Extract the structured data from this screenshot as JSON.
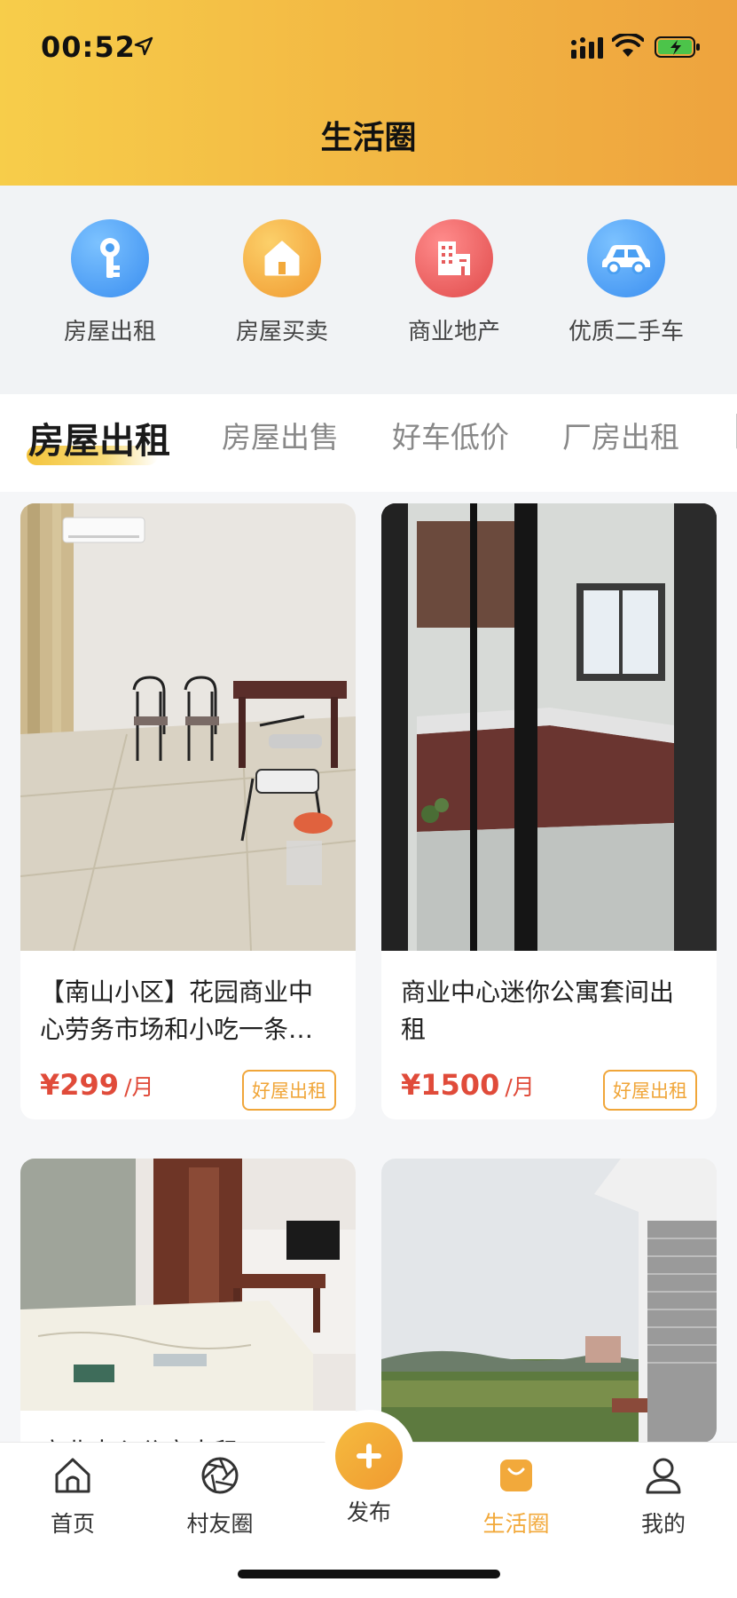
{
  "status_bar": {
    "time": "00:52"
  },
  "header": {
    "title": "生活圈"
  },
  "categories": [
    {
      "label": "房屋出租",
      "icon": "key-icon",
      "color": "#4a9ff2"
    },
    {
      "label": "房屋买卖",
      "icon": "house-icon",
      "color": "#f2a93b"
    },
    {
      "label": "商业地产",
      "icon": "building-icon",
      "color": "#e65c5c"
    },
    {
      "label": "优质二手车",
      "icon": "car-icon",
      "color": "#4a9ff2"
    }
  ],
  "tabs": [
    {
      "label": "房屋出租",
      "active": true
    },
    {
      "label": "房屋出售",
      "active": false
    },
    {
      "label": "好车低价",
      "active": false
    },
    {
      "label": "厂房出租",
      "active": false
    }
  ],
  "listings": [
    {
      "title": "【南山小区】花园商业中心劳务市场和小吃一条街附近",
      "price": "¥299",
      "unit": "/月",
      "tag": "好屋出租"
    },
    {
      "title": "商业中心迷你公寓套间出租",
      "price": "¥1500",
      "unit": "/月",
      "tag": "好屋出租"
    },
    {
      "title": "商业中心公寓出租",
      "price": "",
      "unit": "",
      "tag": ""
    },
    {
      "title": "",
      "price": "",
      "unit": "",
      "tag": ""
    }
  ],
  "bottom_nav": [
    {
      "label": "首页",
      "icon": "home-icon"
    },
    {
      "label": "村友圈",
      "icon": "aperture-icon"
    },
    {
      "label": "发布",
      "icon": "plus-icon"
    },
    {
      "label": "生活圈",
      "icon": "shopping-bag-icon",
      "active": true
    },
    {
      "label": "我的",
      "icon": "user-icon"
    }
  ],
  "colors": {
    "accent": "#f2a93b",
    "price": "#e04b3a",
    "header_start": "#f7cd4a",
    "header_end": "#eea33e"
  }
}
